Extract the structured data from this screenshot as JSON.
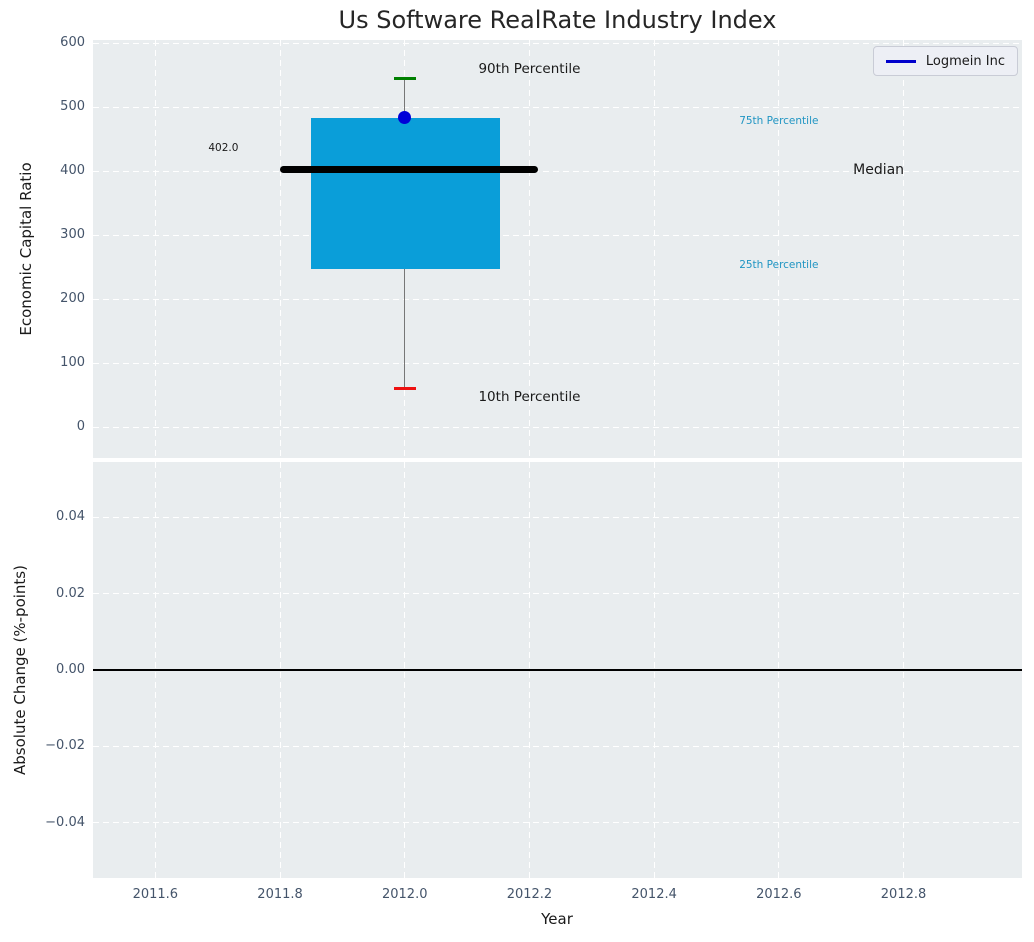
{
  "title": "Us Software RealRate Industry Index",
  "legend": {
    "label": "Logmein Inc",
    "line_color": "#0000cc"
  },
  "colors": {
    "plot_bg": "#e9edef",
    "grid": "#ffffff",
    "tick_label": "#44546a",
    "title": "#262626",
    "text": "#1a1a1a",
    "box_fill": "#0a9ed9",
    "median_line": "#000000",
    "whisker": "#777777",
    "cap_top": "#008000",
    "cap_bottom": "#ee1111",
    "point": "#0000d8",
    "zero_line": "#000000",
    "percentile_label": "#2095c3"
  },
  "chart_data": [
    {
      "type": "boxplot",
      "title": "Us Software RealRate Industry Index",
      "ylabel": "Economic Capital Ratio",
      "xlim": [
        2011.5,
        2012.99
      ],
      "ylim": [
        -48,
        605
      ],
      "yticks": [
        0,
        100,
        200,
        300,
        400,
        500,
        600
      ],
      "ytick_labels": [
        "0",
        "100",
        "200",
        "300",
        "400",
        "500",
        "600"
      ],
      "xticks": [
        2011.6,
        2011.8,
        2012.0,
        2012.2,
        2012.4,
        2012.6,
        2012.8
      ],
      "grid": "white-dashed",
      "box": {
        "x_center": 2012.0,
        "box_left": 2011.85,
        "box_right": 2012.153,
        "p10": 60,
        "p25": 248,
        "median": 402,
        "p75": 483,
        "p90": 545,
        "median_line_left": 2011.8,
        "median_line_right": 2012.213,
        "cap_half_width": 0.018
      },
      "company_point": {
        "label": "Logmein Inc",
        "x": 2012.0,
        "y": 484
      },
      "annotations": [
        {
          "text": "90th Percentile",
          "x": 2012.2,
          "y": 560,
          "color": "#1a1a1a",
          "size": 13.5,
          "align": "center"
        },
        {
          "text": "75th Percentile",
          "x": 2012.6,
          "y": 478,
          "color": "#2095c3",
          "size": 10.5,
          "align": "center"
        },
        {
          "text": "Median",
          "x": 2012.76,
          "y": 402,
          "color": "#1a1a1a",
          "size": 14,
          "align": "center"
        },
        {
          "text": "25th Percentile",
          "x": 2012.6,
          "y": 254,
          "color": "#2095c3",
          "size": 10.5,
          "align": "center"
        },
        {
          "text": "10th Percentile",
          "x": 2012.2,
          "y": 48,
          "color": "#1a1a1a",
          "size": 13.5,
          "align": "center"
        },
        {
          "text": "402.0",
          "x": 2011.685,
          "y": 437,
          "color": "#1a1a1a",
          "size": 10.5,
          "align": "left"
        }
      ]
    },
    {
      "type": "line",
      "ylabel": "Absolute Change (%-points)",
      "xlabel": "Year",
      "xlim": [
        2011.5,
        2012.99
      ],
      "ylim": [
        -0.0545,
        0.0545
      ],
      "yticks": [
        0.04,
        0.02,
        0.0,
        -0.02,
        -0.04
      ],
      "ytick_labels": [
        "0.04",
        "0.02",
        "0.00",
        "−0.02",
        "−0.04"
      ],
      "xticks": [
        2011.6,
        2011.8,
        2012.0,
        2012.2,
        2012.4,
        2012.6,
        2012.8
      ],
      "xtick_labels": [
        "2011.6",
        "2011.8",
        "2012.0",
        "2012.2",
        "2012.4",
        "2012.6",
        "2012.8"
      ],
      "grid": "white-dashed",
      "zero_line": 0.0,
      "series": []
    }
  ]
}
